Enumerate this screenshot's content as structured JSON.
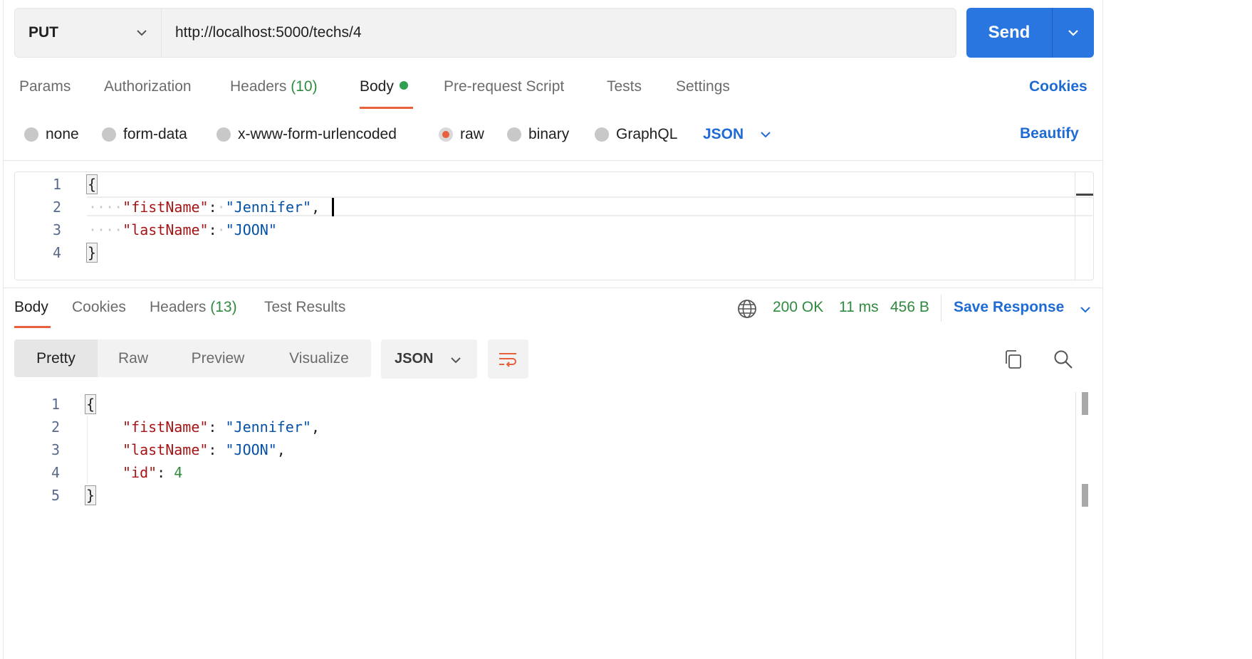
{
  "request": {
    "method": "PUT",
    "url": "http://localhost:5000/techs/4",
    "send_label": "Send"
  },
  "request_tabs": {
    "params": "Params",
    "authorization": "Authorization",
    "headers": "Headers",
    "headers_count": "(10)",
    "body": "Body",
    "prerequest": "Pre-request Script",
    "tests": "Tests",
    "settings": "Settings",
    "cookies": "Cookies"
  },
  "body_types": {
    "none": "none",
    "form_data": "form-data",
    "urlencoded": "x-www-form-urlencoded",
    "raw": "raw",
    "binary": "binary",
    "graphql": "GraphQL",
    "selected": "raw",
    "format": "JSON",
    "beautify": "Beautify"
  },
  "request_body": {
    "line_numbers": [
      "1",
      "2",
      "3",
      "4"
    ],
    "open": "{",
    "key1": "\"fistName\"",
    "val1": "\"Jennifer\"",
    "key2": "\"lastName\"",
    "val2": "\"JOON\"",
    "close": "}",
    "colon": ":",
    "comma": ","
  },
  "response_tabs": {
    "body": "Body",
    "cookies": "Cookies",
    "headers": "Headers",
    "headers_count": "(13)",
    "test_results": "Test Results"
  },
  "response_status": {
    "status": "200 OK",
    "time": "11 ms",
    "size": "456 B",
    "save_response": "Save Response"
  },
  "response_view": {
    "pretty": "Pretty",
    "raw": "Raw",
    "preview": "Preview",
    "visualize": "Visualize",
    "format": "JSON"
  },
  "response_body": {
    "line_numbers": [
      "1",
      "2",
      "3",
      "4",
      "5"
    ],
    "open": "{",
    "key1": "\"fistName\"",
    "val1": "\"Jennifer\"",
    "key2": "\"lastName\"",
    "val2": "\"JOON\"",
    "key3": "\"id\"",
    "val3": "4",
    "close": "}",
    "colon": ":",
    "comma": ","
  },
  "colors": {
    "accent_blue": "#2a76e0",
    "link_blue": "#1f6bd4",
    "active_orange": "#e8603c",
    "status_green": "#2f8a3f"
  },
  "icons": [
    "chevron-down-icon",
    "globe-icon",
    "wrap-lines-icon",
    "copy-icon",
    "search-icon"
  ]
}
